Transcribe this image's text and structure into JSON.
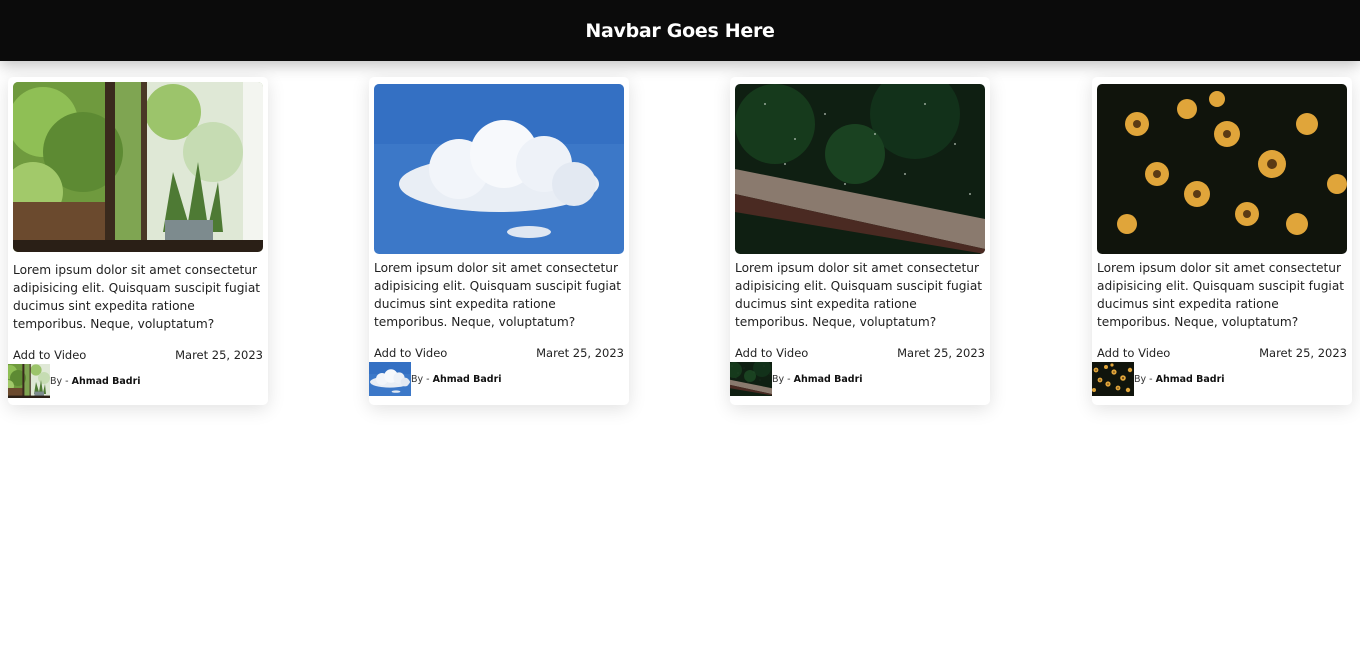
{
  "navbar": {
    "title": "Navbar Goes Here"
  },
  "cards": [
    {
      "image": "window-plant-photo",
      "description": "Lorem ipsum dolor sit amet consectetur adipisicing elit. Quisquam suscipit fugiat ducimus sint expedita ratione temporibus. Neque, voluptatum?",
      "action_label": "Add to Video",
      "date": "Maret 25, 2023",
      "by_label": "By -",
      "author": "Ahmad Badri"
    },
    {
      "image": "cloud-sky-photo",
      "description": "Lorem ipsum dolor sit amet consectetur adipisicing elit. Quisquam suscipit fugiat ducimus sint expedita ratione temporibus. Neque, voluptatum?",
      "action_label": "Add to Video",
      "date": "Maret 25, 2023",
      "by_label": "By -",
      "author": "Ahmad Badri"
    },
    {
      "image": "rain-railing-photo",
      "description": "Lorem ipsum dolor sit amet consectetur adipisicing elit. Quisquam suscipit fugiat ducimus sint expedita ratione temporibus. Neque, voluptatum?",
      "action_label": "Add to Video",
      "date": "Maret 25, 2023",
      "by_label": "By -",
      "author": "Ahmad Badri"
    },
    {
      "image": "yellow-flowers-photo",
      "description": "Lorem ipsum dolor sit amet consectetur adipisicing elit. Quisquam suscipit fugiat ducimus sint expedita ratione temporibus. Neque, voluptatum?",
      "action_label": "Add to Video",
      "date": "Maret 25, 2023",
      "by_label": "By -",
      "author": "Ahmad Badri"
    }
  ]
}
